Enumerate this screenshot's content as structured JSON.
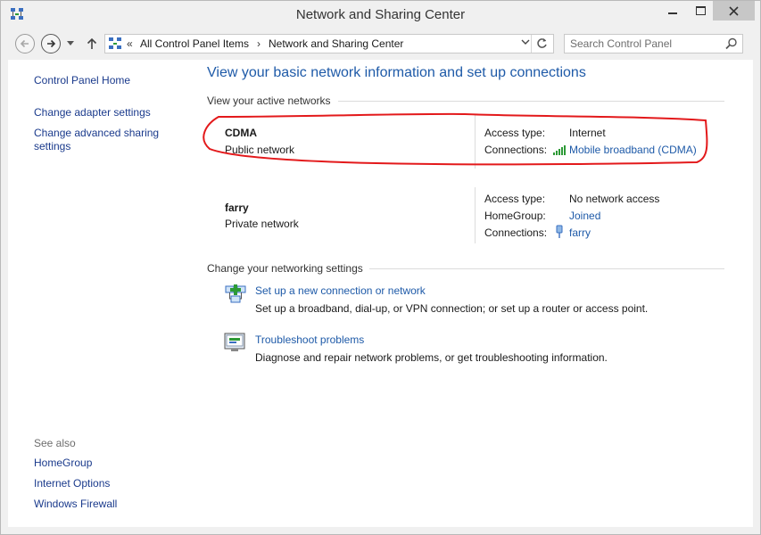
{
  "window": {
    "title": "Network and Sharing Center",
    "app_icon": "network-icon",
    "controls": [
      "minimize-icon",
      "maximize-icon",
      "close-icon"
    ]
  },
  "address": {
    "overflow": "«",
    "crumbs": [
      "All Control Panel Items",
      "Network and Sharing Center"
    ],
    "separator": "›",
    "search_placeholder": "Search Control Panel"
  },
  "left_pane": {
    "home": "Control Panel Home",
    "links": [
      "Change adapter settings",
      "Change advanced sharing",
      "settings"
    ],
    "see_also_title": "See also",
    "see_also": [
      "HomeGroup",
      "Internet Options",
      "Windows Firewall"
    ]
  },
  "main": {
    "title": "View your basic network information and set up connections",
    "active_networks_heading": "View your active networks",
    "networks": [
      {
        "name": "CDMA",
        "type": "Public network",
        "access_type_label": "Access type:",
        "access_type": "Internet",
        "connections_label": "Connections:",
        "connection": "Mobile broadband (CDMA)",
        "connection_icon": "signal-bars-icon"
      },
      {
        "name": "farry",
        "type": "Private network",
        "access_type_label": "Access type:",
        "access_type": "No network access",
        "homegroup_label": "HomeGroup:",
        "homegroup": "Joined",
        "connections_label": "Connections:",
        "connection": "farry",
        "connection_icon": "ethernet-plug-icon"
      }
    ],
    "change_heading": "Change your networking settings",
    "tasks": [
      {
        "link": "Set up a new connection or network",
        "desc": "Set up a broadband, dial-up, or VPN connection; or set up a router or access point.",
        "icon": "new-connection-icon"
      },
      {
        "link": "Troubleshoot problems",
        "desc": "Diagnose and repair network problems, or get troubleshooting information.",
        "icon": "troubleshoot-icon"
      }
    ]
  },
  "colors": {
    "link": "#1e5aa8",
    "highlight_annotation": "#e3191b"
  }
}
